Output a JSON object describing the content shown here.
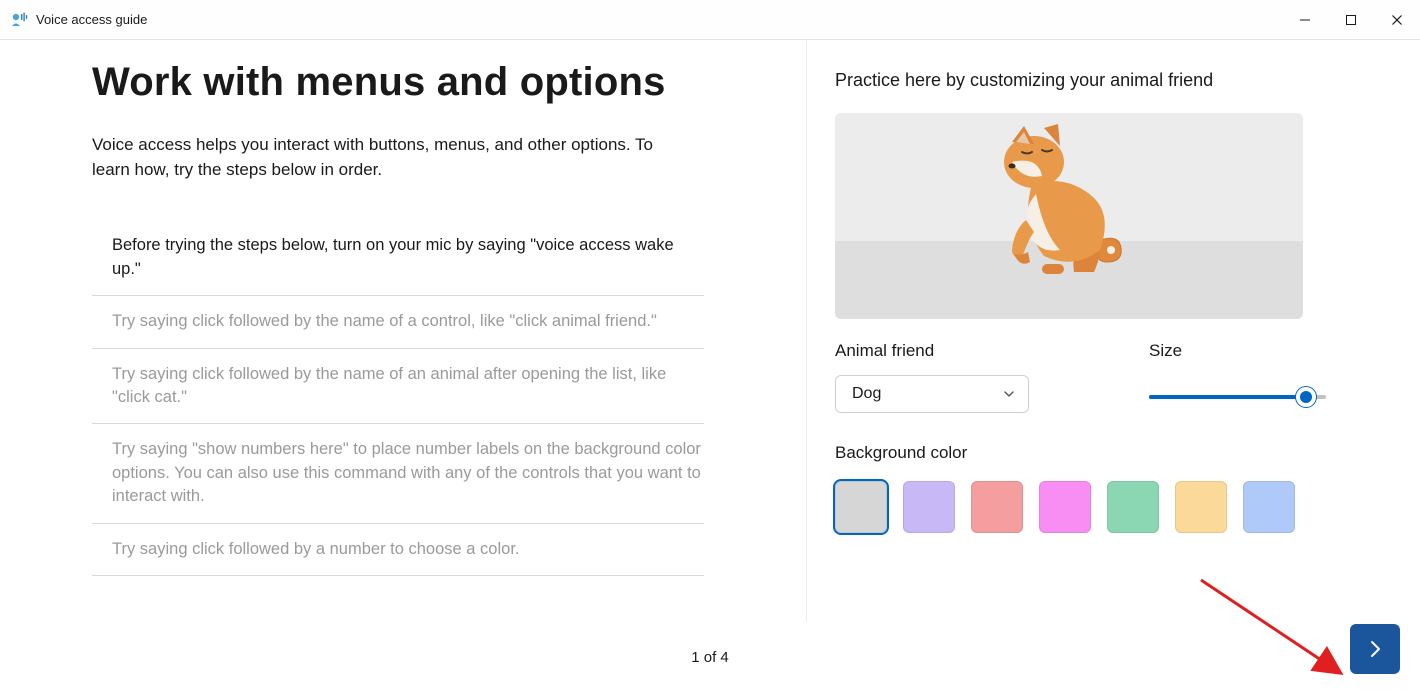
{
  "window": {
    "title": "Voice access guide"
  },
  "left": {
    "heading": "Work with menus and options",
    "description": "Voice access helps you interact with buttons, menus, and other options. To learn how, try the steps below in order.",
    "steps": [
      "Before trying the steps below, turn on your mic by saying \"voice access wake up.\"",
      "Try saying click followed by the name of a control, like \"click animal friend.\"",
      "Try saying click followed by the name of an animal after opening the list, like \"click cat.\"",
      "Try saying \"show numbers here\" to place number labels on the background color options. You can also use this command with any of the controls that you want to interact with.",
      "Try saying click followed by a number to choose a color."
    ],
    "active_step_index": 0
  },
  "right": {
    "practice_label": "Practice here by customizing your animal friend",
    "animal_friend_label": "Animal friend",
    "animal_friend_value": "Dog",
    "size_label": "Size",
    "size_percent": 80,
    "bg_label": "Background color",
    "colors": [
      "#d6d6d6",
      "#c9b8f6",
      "#f59ea0",
      "#f88ef4",
      "#8bd6b3",
      "#fbd998",
      "#afc9f8"
    ],
    "selected_color_index": 0
  },
  "pager": {
    "text": "1 of 4"
  }
}
